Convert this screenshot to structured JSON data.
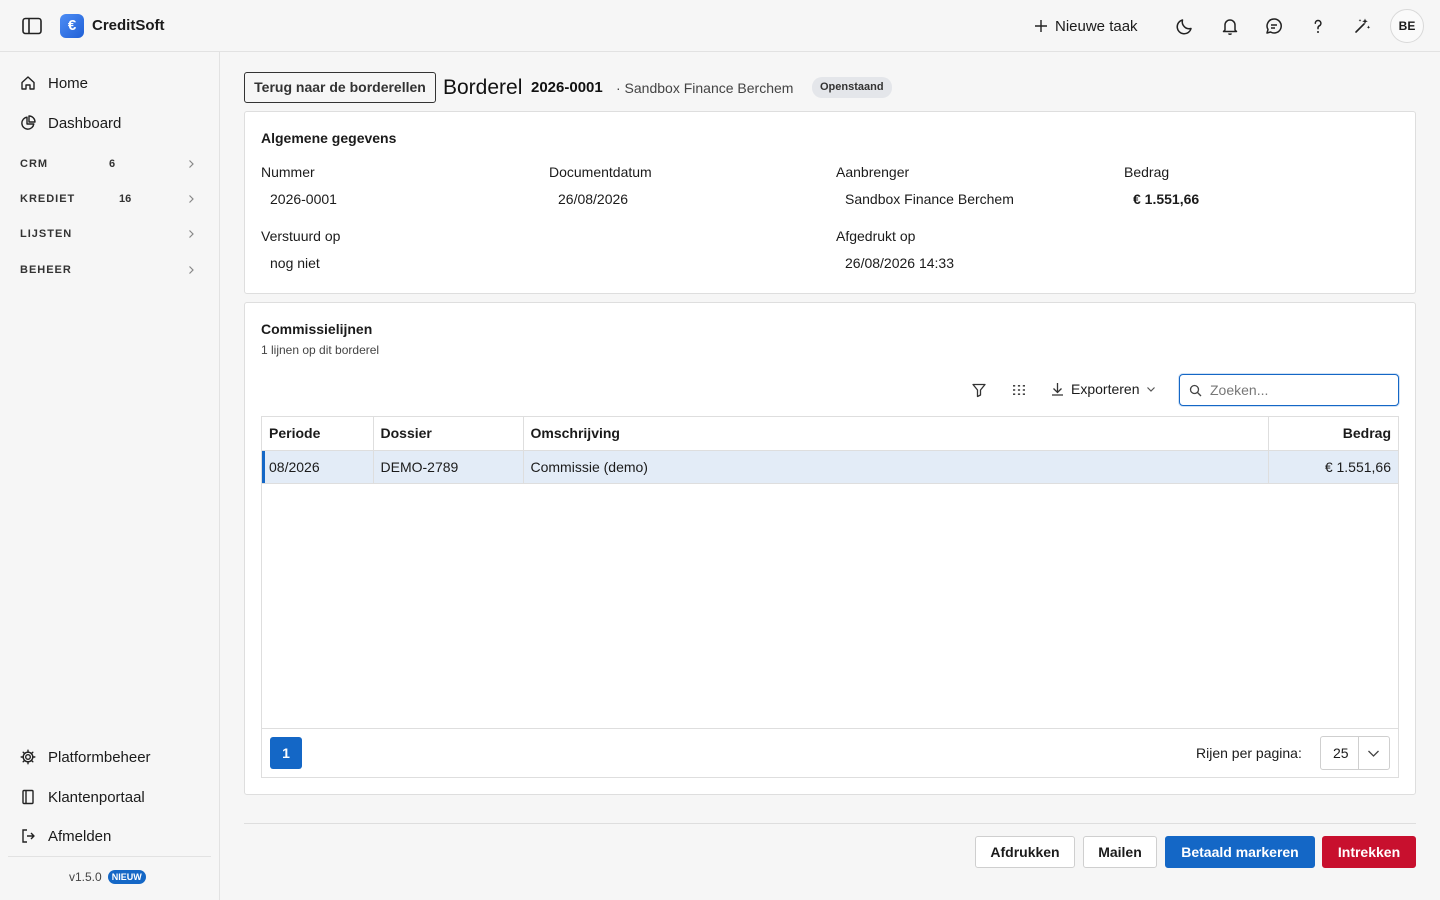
{
  "app": {
    "name": "CreditSoft",
    "logo_glyph": "€",
    "brand_color": "#1467c6"
  },
  "topbar": {
    "new_task_label": "Nieuwe taak",
    "icons": [
      "sidebar-toggle-icon",
      "plus-icon",
      "moon-icon",
      "bell-icon",
      "chat-icon",
      "help-icon",
      "sparkle-icon"
    ],
    "avatar_initials": "BE"
  },
  "sidebar": {
    "top_items": [
      {
        "label": "Home",
        "icon": "home-icon"
      },
      {
        "label": "Dashboard",
        "icon": "chart-pie-icon"
      }
    ],
    "groups": [
      {
        "label": "CRM",
        "count": "6"
      },
      {
        "label": "KREDIET",
        "count": "16"
      },
      {
        "label": "LIJSTEN",
        "count": ""
      },
      {
        "label": "BEHEER",
        "count": ""
      }
    ],
    "bottom_items": [
      {
        "label": "Platformbeheer",
        "icon": "gear-icon"
      },
      {
        "label": "Klantenportaal",
        "icon": "book-icon"
      },
      {
        "label": "Afmelden",
        "icon": "logout-icon"
      }
    ],
    "version": "v1.5.0",
    "version_badge": "NIEUW"
  },
  "header": {
    "back_label": "Terug naar de borderellen",
    "title": "Borderel",
    "number": "2026-0001",
    "subtitle": "· Sandbox Finance Berchem",
    "status": "Openstaand"
  },
  "general": {
    "title": "Algemene gegevens",
    "fields": [
      {
        "label": "Nummer",
        "value": "2026-0001"
      },
      {
        "label": "Documentdatum",
        "value": "26/08/2026"
      },
      {
        "label": "Aanbrenger",
        "value": "Sandbox Finance Berchem"
      },
      {
        "label": "Bedrag",
        "value": "€ 1.551,66"
      },
      {
        "label": "Verstuurd op",
        "value": "nog niet"
      },
      {
        "label": "Afgedrukt op",
        "value": "26/08/2026 14:33"
      }
    ]
  },
  "lines": {
    "title": "Commissielijnen",
    "subtitle": "1 lijnen op dit borderel",
    "export_label": "Exporteren",
    "search_placeholder": "Zoeken...",
    "columns": [
      "Periode",
      "Dossier",
      "Omschrijving",
      "Bedrag"
    ],
    "rows": [
      {
        "periode": "08/2026",
        "dossier": "DEMO-2789",
        "omschrijving": "Commissie (demo)",
        "bedrag": "€ 1.551,66"
      }
    ],
    "current_page": "1",
    "rows_per_page_label": "Rijen per pagina:",
    "rows_per_page": "25"
  },
  "actions": {
    "print": "Afdrukken",
    "mail": "Mailen",
    "mark_paid": "Betaald markeren",
    "revoke": "Intrekken"
  }
}
